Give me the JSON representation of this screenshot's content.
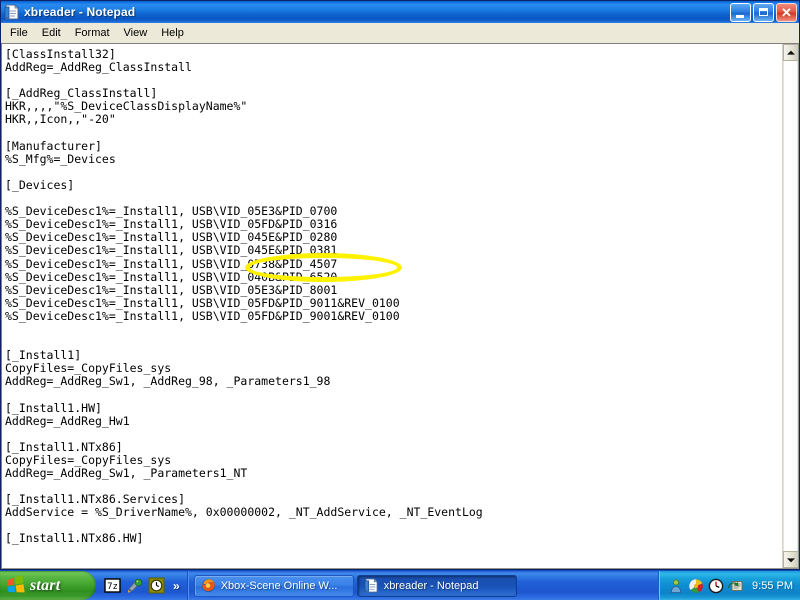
{
  "window": {
    "title": "xbreader - Notepad",
    "icon": "notepad-icon",
    "buttons": {
      "minimize": "minimize-button",
      "maximize": "maximize-button",
      "close_glyph": "✕"
    },
    "menu": [
      "File",
      "Edit",
      "Format",
      "View",
      "Help"
    ]
  },
  "document": {
    "lines": [
      "[ClassInstall32]",
      "AddReg=_AddReg_ClassInstall",
      "",
      "[_AddReg_ClassInstall]",
      "HKR,,,,\"%S_DeviceClassDisplayName%\"",
      "HKR,,Icon,,\"-20\"",
      "",
      "[Manufacturer]",
      "%S_Mfg%=_Devices",
      "",
      "[_Devices]",
      "",
      "%S_DeviceDesc1%=_Install1, USB\\VID_05E3&PID_0700",
      "%S_DeviceDesc1%=_Install1, USB\\VID_05FD&PID_0316",
      "%S_DeviceDesc1%=_Install1, USB\\VID_045E&PID_0280",
      "%S_DeviceDesc1%=_Install1, USB\\VID_045E&PID_0381",
      "%S_DeviceDesc1%=_Install1, USB\\VID_0738&PID_4507",
      "%S_DeviceDesc1%=_Install1, USB\\VID_040B&PID_6520",
      "%S_DeviceDesc1%=_Install1, USB\\VID_05E3&PID_8001",
      "%S_DeviceDesc1%=_Install1, USB\\VID_05FD&PID_9011&REV_0100",
      "%S_DeviceDesc1%=_Install1, USB\\VID_05FD&PID_9001&REV_0100",
      "",
      "",
      "[_Install1]",
      "CopyFiles=_CopyFiles_sys",
      "AddReg=_AddReg_Sw1, _AddReg_98, _Parameters1_98",
      "",
      "[_Install1.HW]",
      "AddReg=_AddReg_Hw1",
      "",
      "[_Install1.NTx86]",
      "CopyFiles=_CopyFiles_sys",
      "AddReg=_AddReg_Sw1, _Parameters1_NT",
      "",
      "[_Install1.NTx86.Services]",
      "AddService = %S_DriverName%, 0x00000002, _NT_AddService, _NT_EventLog",
      "",
      "[_Install1.NTx86.HW]"
    ]
  },
  "annotation": {
    "shape": "ellipse",
    "color": "#fff200",
    "target_text": "VID_05E3&PID_0700"
  },
  "scrollbar": {
    "up_arrow": "scroll-up-arrow",
    "down_arrow": "scroll-down-arrow"
  },
  "taskbar": {
    "start_label": "start",
    "quick_launch": [
      {
        "name": "7zip-icon",
        "label": "7z"
      },
      {
        "name": "paint-icon",
        "label": ""
      },
      {
        "name": "clock-icon",
        "label": ""
      }
    ],
    "quick_launch_chevron": "»",
    "tasks": [
      {
        "name": "firefox-task",
        "label": "Xbox-Scene Online W...",
        "active": false,
        "icon": "firefox-icon"
      },
      {
        "name": "notepad-task",
        "label": "xbreader - Notepad",
        "active": true,
        "icon": "notepad-icon"
      }
    ],
    "tray_icons": [
      "messenger-icon",
      "colorwheel-icon",
      "clock-tray-icon",
      "updates-icon"
    ],
    "clock": "9:55 PM"
  },
  "colors": {
    "titlebar_blue": "#0a5fc8",
    "taskbar_blue": "#245edb",
    "start_green": "#4aa83a",
    "highlight_yellow": "#fff200",
    "window_face": "#ece9d8"
  }
}
